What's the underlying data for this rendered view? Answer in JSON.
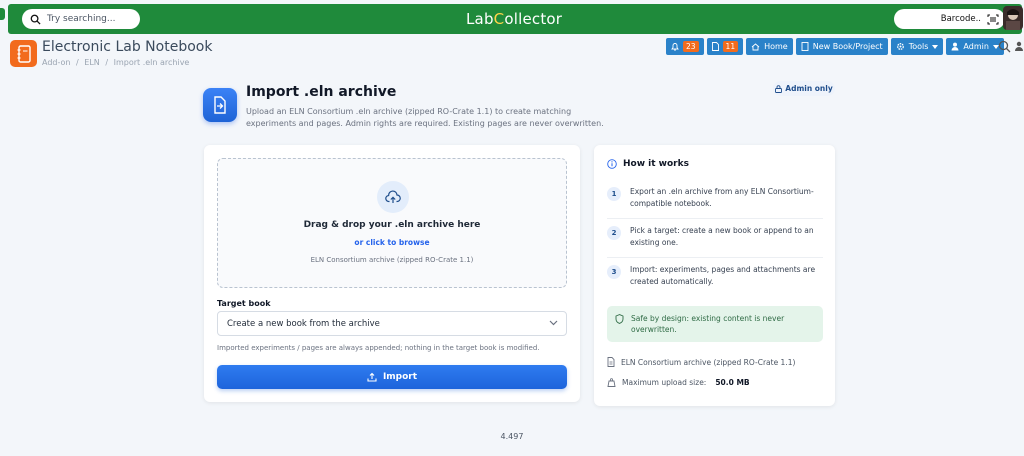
{
  "topbar": {
    "search_placeholder": "Try searching...",
    "logo_left": "Lab",
    "logo_c": "C",
    "logo_right": "ollector",
    "barcode_label": "Barcode..",
    "brand_color": "#1f8a3b"
  },
  "header": {
    "app_title": "Electronic Lab Notebook",
    "breadcrumb": [
      "Add-on",
      "/",
      "ELN",
      "/",
      "Import .eln archive"
    ]
  },
  "nav": {
    "notifications_count": "23",
    "documents_count": "11",
    "home_label": "Home",
    "new_book_label": "New Book/Project",
    "tools_label": "Tools",
    "admin_label": "Admin"
  },
  "page": {
    "title": "Import .eln archive",
    "description": "Upload an ELN Consortium .eln archive (zipped RO-Crate 1.1) to create matching experiments and pages. Admin rights are required. Existing pages are never overwritten.",
    "admin_badge": "Admin only"
  },
  "upload": {
    "drop_title": "Drag & drop your .eln archive here",
    "browse_link": "or click to browse",
    "format_note": "ELN Consortium archive (zipped RO-Crate 1.1)",
    "target_label": "Target book",
    "target_value": "Create a new book from the archive",
    "help_text": "Imported experiments / pages are always appended; nothing in the target book is modified.",
    "import_label": "Import"
  },
  "how_it_works": {
    "title": "How it works",
    "steps": [
      {
        "num": "1",
        "text": "Export an .eln archive from any ELN Consortium-compatible notebook."
      },
      {
        "num": "2",
        "text": "Pick a target: create a new book or append to an existing one."
      },
      {
        "num": "3",
        "text": "Import: experiments, pages and attachments are created automatically."
      }
    ],
    "safe_note": "Safe by design: existing content is never overwritten.",
    "format_info": "ELN Consortium archive (zipped RO-Crate 1.1)",
    "max_upload_label": "Maximum upload size:",
    "max_upload_value": "50.0 MB"
  },
  "footer": {
    "version": "4.497"
  }
}
